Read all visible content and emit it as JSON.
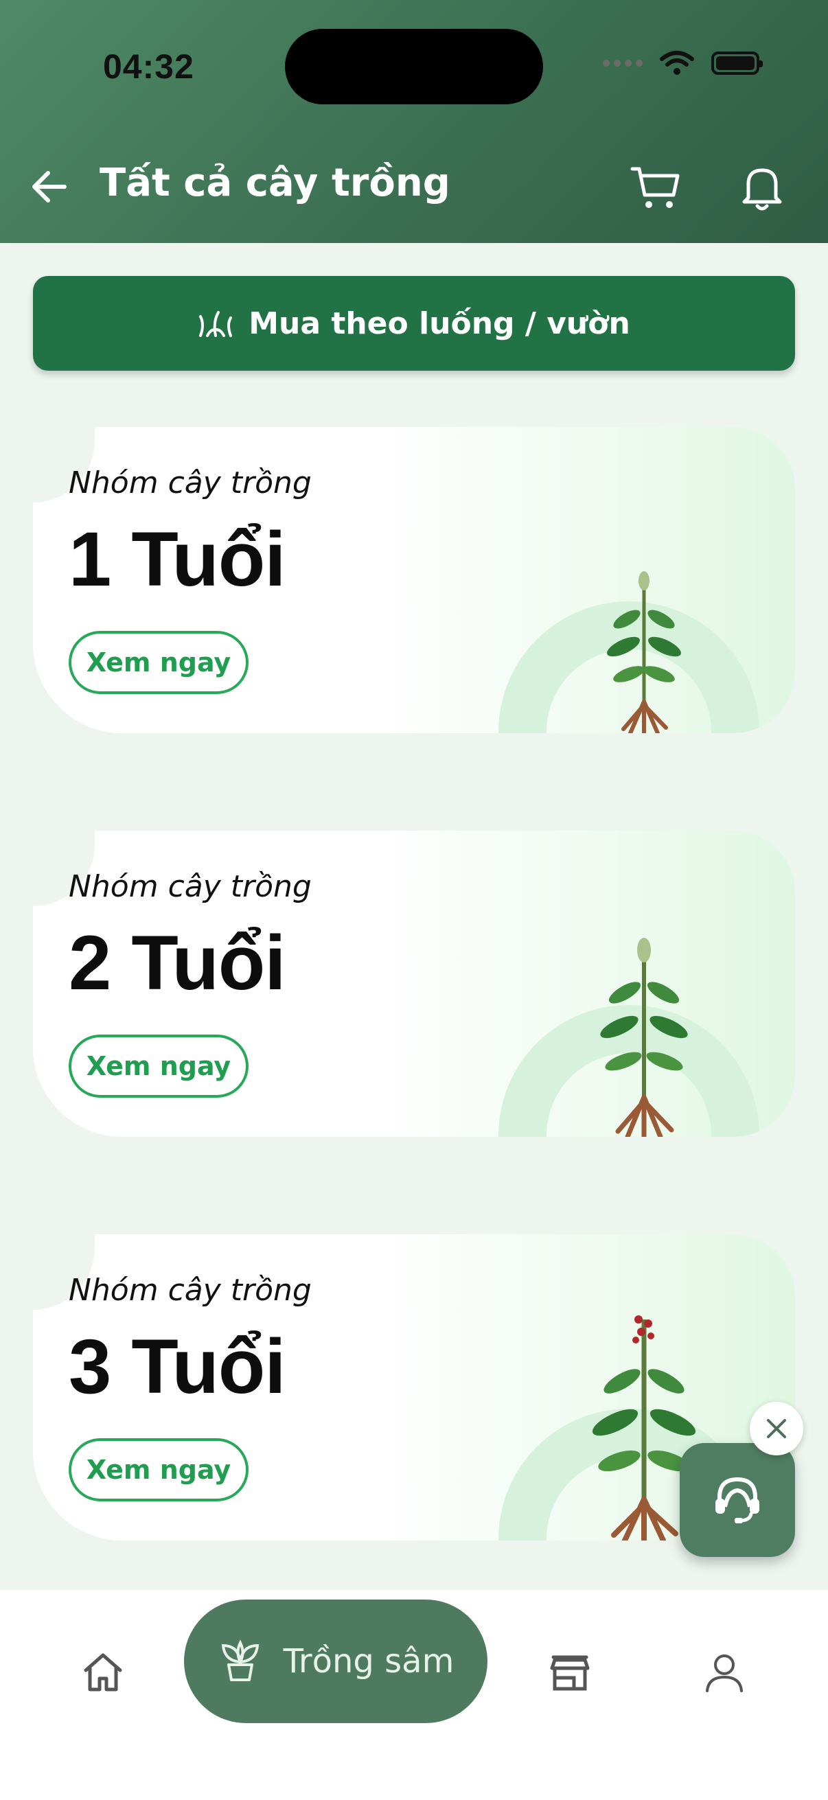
{
  "status_bar": {
    "time": "04:32"
  },
  "header": {
    "title": "Tất cả cây trồng"
  },
  "buy_button": {
    "label": "Mua theo luống / vườn"
  },
  "cards": [
    {
      "kicker": "Nhóm cây trồng",
      "title": "1 Tuổi",
      "cta": "Xem ngay"
    },
    {
      "kicker": "Nhóm cây trồng",
      "title": "2 Tuổi",
      "cta": "Xem ngay"
    },
    {
      "kicker": "Nhóm cây trồng",
      "title": "3 Tuổi",
      "cta": "Xem ngay"
    }
  ],
  "bottom_nav": {
    "items": [
      {
        "icon": "home-icon"
      },
      {
        "icon": "sprout-icon",
        "label": "Trồng sâm",
        "active": true
      },
      {
        "icon": "store-icon"
      },
      {
        "icon": "user-icon"
      }
    ]
  },
  "colors": {
    "header": "#3f7556",
    "primary": "#217346",
    "accent_green": "#27a95a",
    "active_nav": "#4e7b5f",
    "background": "#eef5ef"
  },
  "icons": {
    "back": "arrow-left-icon",
    "cart": "cart-icon",
    "bell": "bell-icon",
    "buy": "grass-icon",
    "support": "support-agent-icon",
    "close": "close-icon"
  }
}
